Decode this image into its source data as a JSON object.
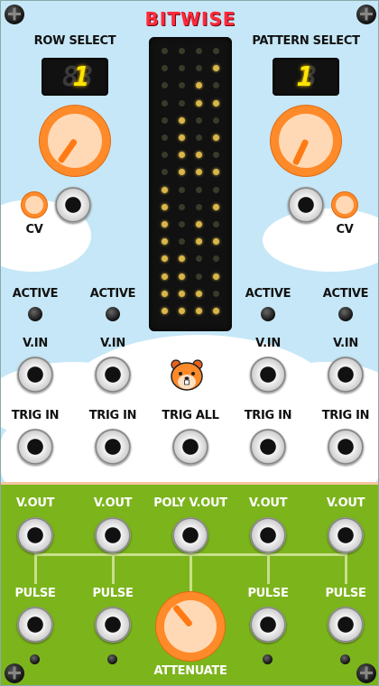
{
  "module": {
    "title": "BITWISE",
    "colors": {
      "accent": "#ff2a3a",
      "knob": "#ff8a2a",
      "background": "#c6e7f7",
      "lower_panel": "#7cb41c",
      "led_on": "#d9b64a",
      "led_off": "#3a3a2a"
    }
  },
  "row_select": {
    "label": "ROW SELECT",
    "display_dim": "8",
    "display_lit": "1",
    "cv_label": "CV"
  },
  "pattern_select": {
    "label": "PATTERN SELECT",
    "display_dim": "8",
    "display_lit": "1",
    "cv_label": "CV"
  },
  "matrix": {
    "columns": 4,
    "rows": [
      [
        0,
        0,
        0,
        0
      ],
      [
        0,
        0,
        0,
        1
      ],
      [
        0,
        0,
        1,
        0
      ],
      [
        0,
        0,
        1,
        1
      ],
      [
        0,
        1,
        0,
        0
      ],
      [
        0,
        1,
        0,
        1
      ],
      [
        0,
        1,
        1,
        0
      ],
      [
        0,
        1,
        1,
        1
      ],
      [
        1,
        0,
        0,
        0
      ],
      [
        1,
        0,
        0,
        1
      ],
      [
        1,
        0,
        1,
        0
      ],
      [
        1,
        0,
        1,
        1
      ],
      [
        1,
        1,
        0,
        0
      ],
      [
        1,
        1,
        0,
        1
      ],
      [
        1,
        1,
        1,
        0
      ],
      [
        1,
        1,
        1,
        1
      ]
    ]
  },
  "channels": {
    "active_label": "ACTIVE",
    "vin_label": "V.IN",
    "trig_in_label": "TRIG IN",
    "trig_all_label": "TRIG ALL"
  },
  "outputs": {
    "vout_label": "V.OUT",
    "poly_vout_label": "POLY V.OUT",
    "pulse_label": "PULSE",
    "attenuate_label": "ATTENUATE"
  },
  "mascot_icon": "hamster-icon"
}
